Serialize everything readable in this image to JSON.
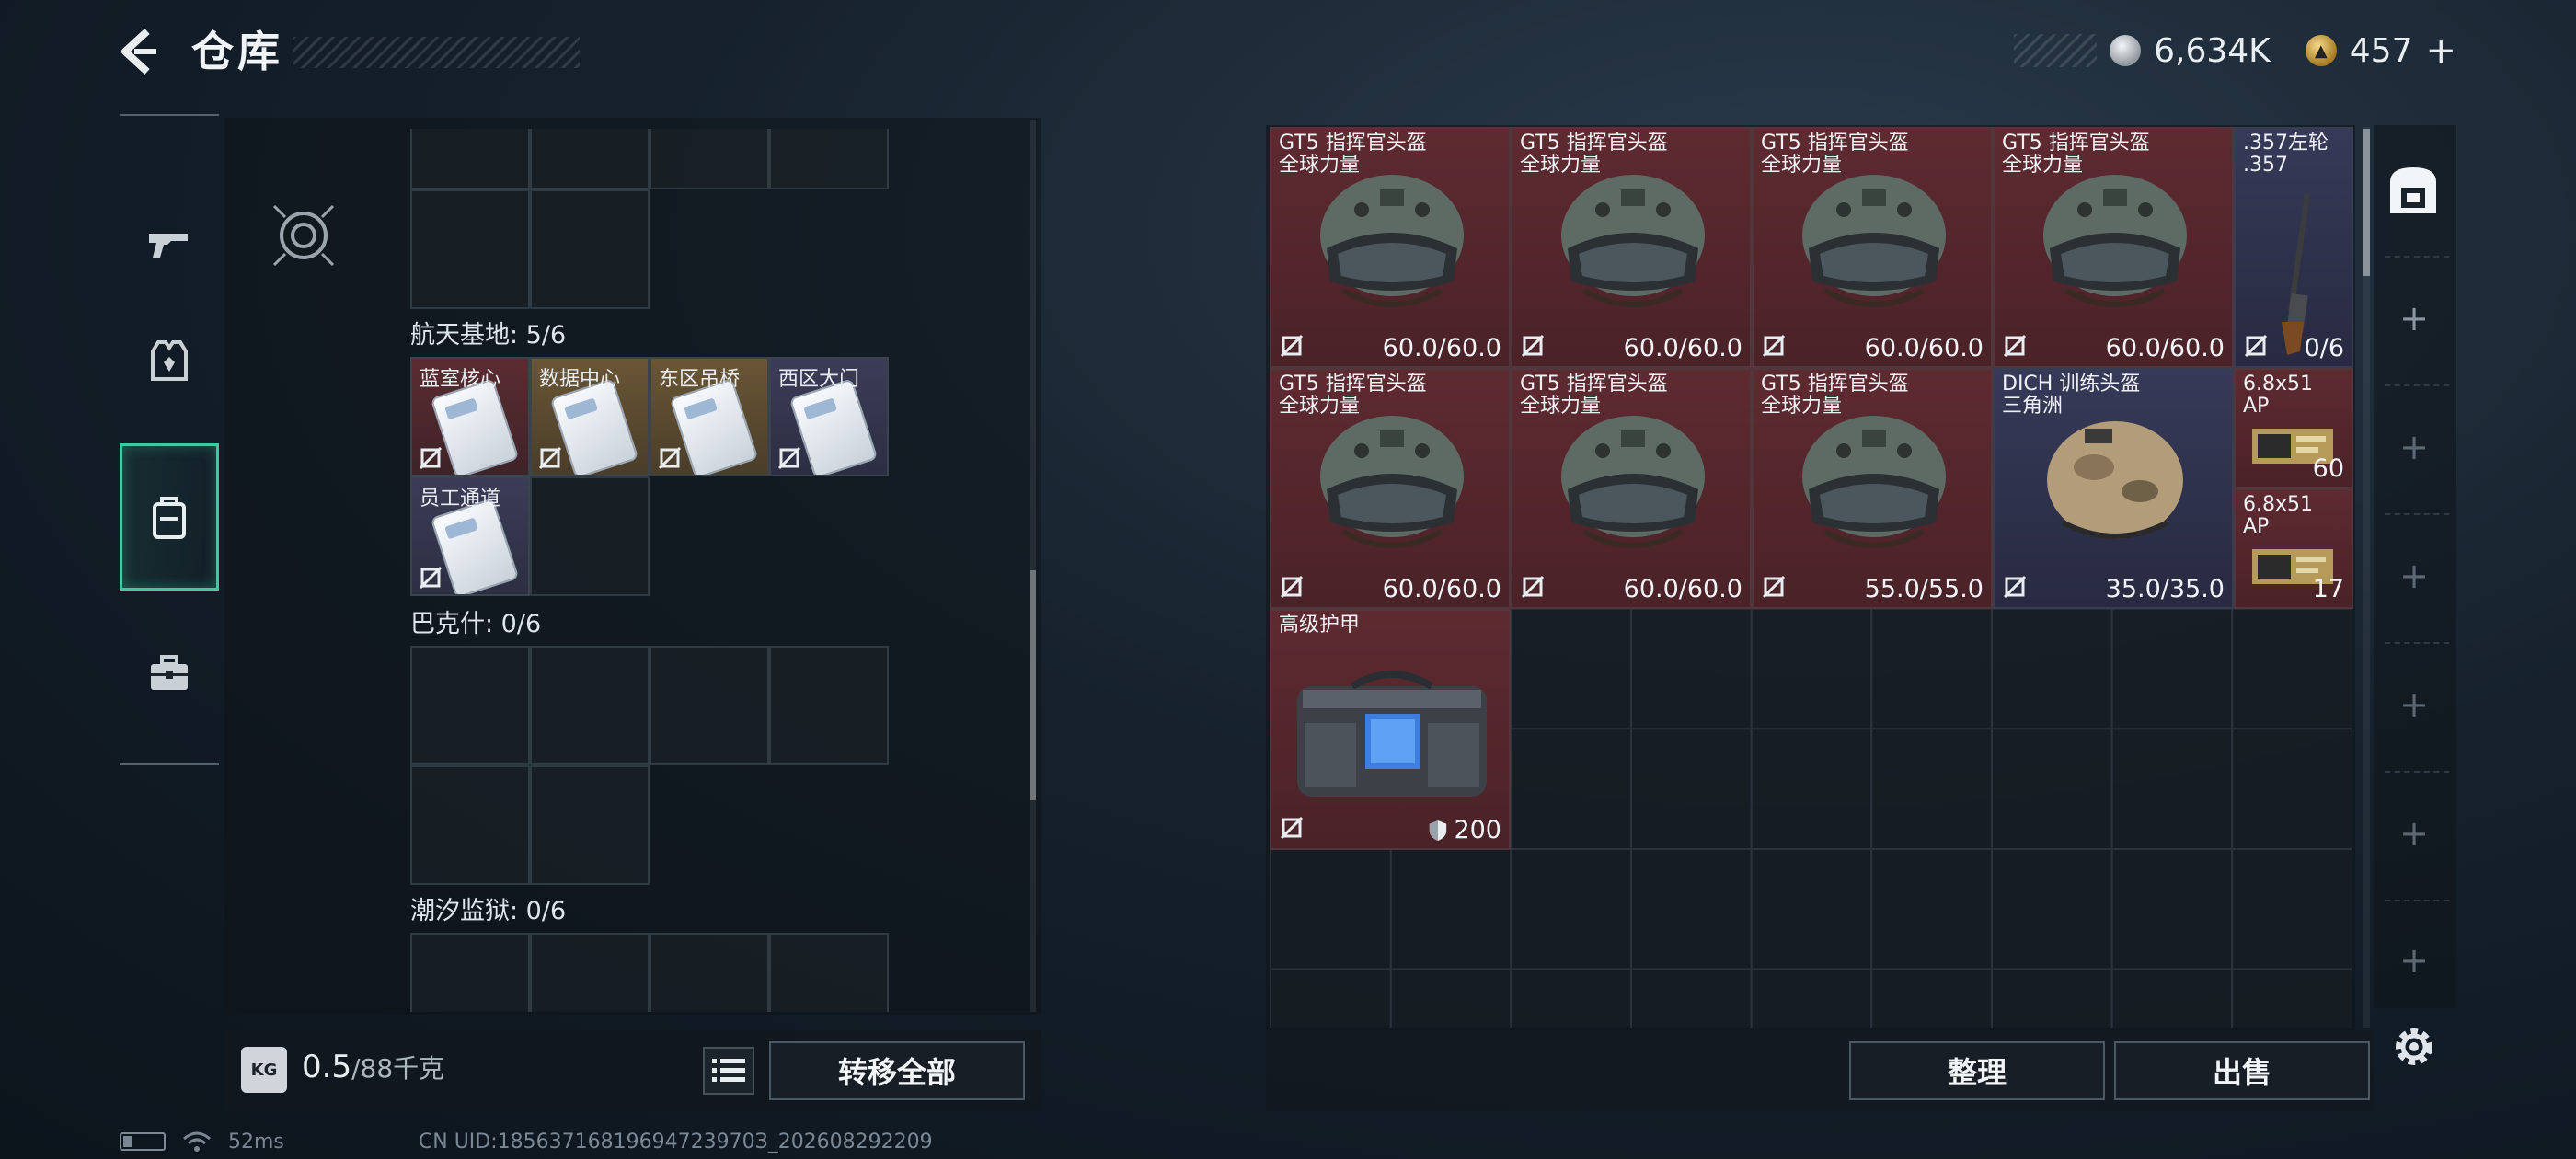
{
  "header": {
    "title": "仓库",
    "silver_amount": "6,634K",
    "gold_amount": "457",
    "gold_plus": "+"
  },
  "left_nav": {
    "items": [
      {
        "icon": "pistol-icon",
        "active": false
      },
      {
        "icon": "armor-vest-icon",
        "active": false
      },
      {
        "icon": "backpack-icon",
        "active": true
      },
      {
        "icon": "toolbox-icon",
        "active": false
      }
    ]
  },
  "key_panel": {
    "sections": [
      {
        "label": "航天基地: 5/6"
      },
      {
        "label": "巴克什: 0/6"
      },
      {
        "label": "潮汐监狱: 0/6"
      }
    ],
    "keys": [
      {
        "name": "蓝室核心",
        "rarity": "red"
      },
      {
        "name": "数据中心",
        "rarity": "gold"
      },
      {
        "name": "东区吊桥",
        "rarity": "gold"
      },
      {
        "name": "西区大门",
        "rarity": "purple"
      },
      {
        "name": "员工通道",
        "rarity": "purple"
      }
    ]
  },
  "weight": {
    "icon_label": "KG",
    "current": "0.5",
    "max": "/88千克"
  },
  "buttons": {
    "transfer_all": "转移全部",
    "sort": "整理",
    "sell": "出售"
  },
  "stash_items": [
    {
      "name": "GT5 指挥官头盔\n全球力量",
      "value": "60.0/60.0",
      "rarity": "red"
    },
    {
      "name": "GT5 指挥官头盔\n全球力量",
      "value": "60.0/60.0",
      "rarity": "red"
    },
    {
      "name": "GT5 指挥官头盔\n全球力量",
      "value": "60.0/60.0",
      "rarity": "red"
    },
    {
      "name": "GT5 指挥官头盔\n全球力量",
      "value": "60.0/60.0",
      "rarity": "red"
    },
    {
      "name": ".357左轮\n.357",
      "value": "0/6",
      "rarity": "purple"
    },
    {
      "name": "GT5 指挥官头盔\n全球力量",
      "value": "60.0/60.0",
      "rarity": "red"
    },
    {
      "name": "GT5 指挥官头盔\n全球力量",
      "value": "60.0/60.0",
      "rarity": "red"
    },
    {
      "name": "GT5 指挥官头盔\n全球力量",
      "value": "55.0/55.0",
      "rarity": "red"
    },
    {
      "name": "DICH 训练头盔\n三角洲",
      "value": "35.0/35.0",
      "rarity": "purple"
    },
    {
      "name": "6.8x51\nAP",
      "value": "60",
      "rarity": "red"
    },
    {
      "name": "6.8x51\nAP",
      "value": "17",
      "rarity": "red"
    },
    {
      "name": "高级护甲",
      "value": "200",
      "rarity": "red"
    }
  ],
  "status": {
    "ping": "52ms",
    "uid": "CN UID:18563716819694723970З_202608292209"
  },
  "colors": {
    "active_tab": "#3fc9a0",
    "red_rarity": "#5e2a31",
    "purple_rarity": "#363a58",
    "gold_rarity": "#6a5636"
  }
}
